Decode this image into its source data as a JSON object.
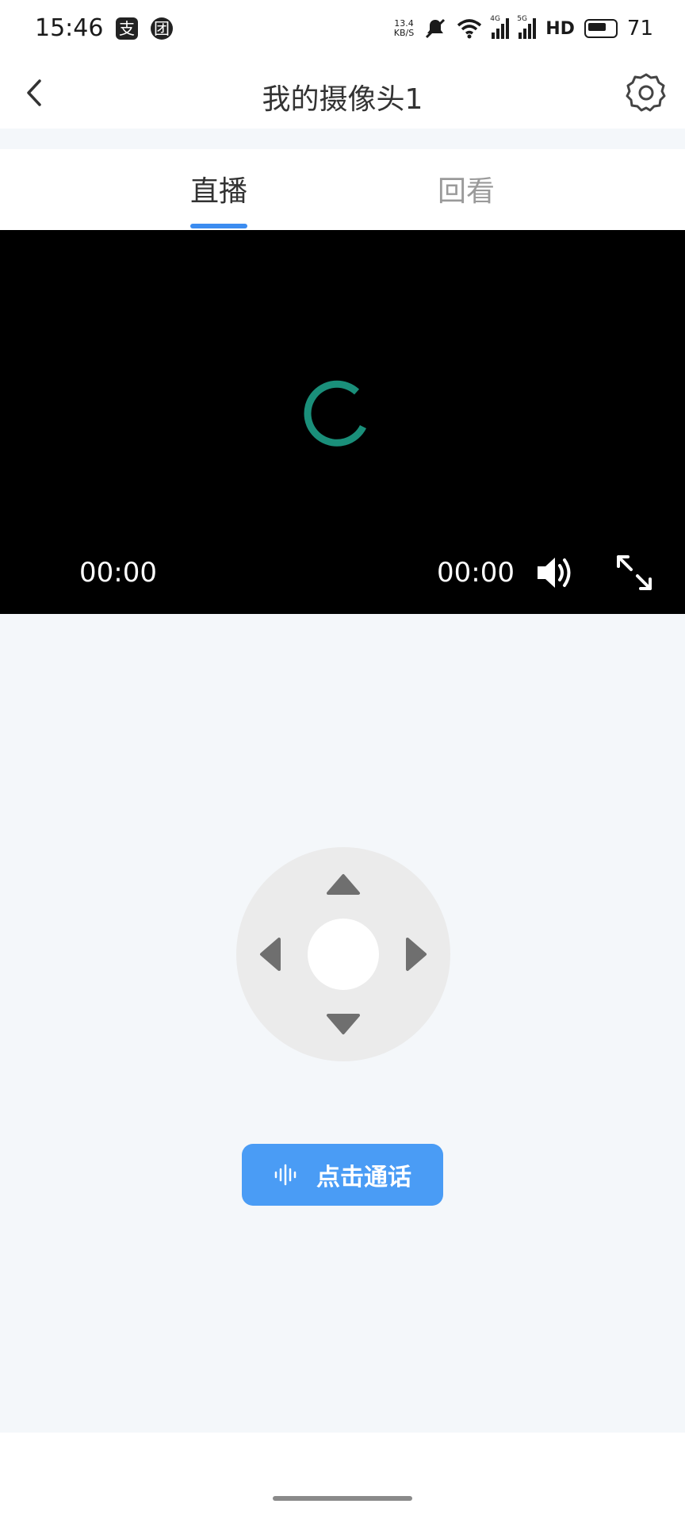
{
  "status_bar": {
    "time": "15:46",
    "app_icon_1": "支",
    "app_icon_2": "团",
    "net_speed_value": "13.4",
    "net_speed_unit": "KB/S",
    "signal_1_gen": "4G",
    "signal_2_gen": "5G",
    "hd_label": "HD",
    "battery": "71"
  },
  "header": {
    "title": "我的摄像头1",
    "back_icon": "chevron-left-icon",
    "settings_icon": "gear-icon"
  },
  "tabs": [
    {
      "label": "直播",
      "active": true
    },
    {
      "label": "回看",
      "active": false
    }
  ],
  "player": {
    "time_current": "00:00",
    "time_total": "00:00",
    "spinner_color": "#1a8f7a"
  },
  "talk_button": {
    "label": "点击通话",
    "color": "#4a9cf5"
  },
  "colors": {
    "accent": "#3b8cf0",
    "background": "#f4f7fa"
  }
}
